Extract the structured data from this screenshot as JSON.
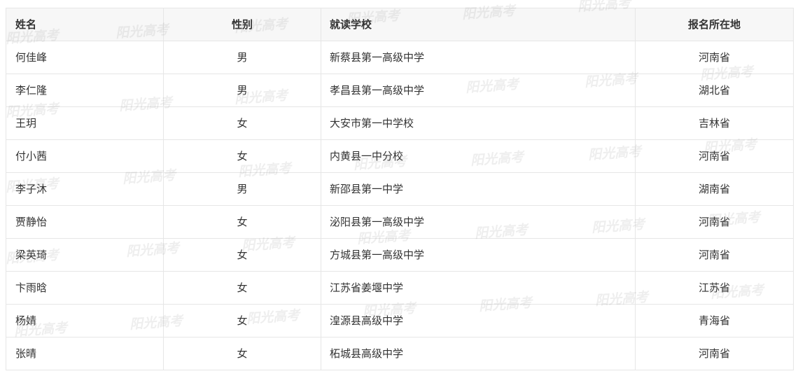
{
  "table": {
    "headers": {
      "name": "姓名",
      "gender": "性别",
      "school": "就读学校",
      "province": "报名所在地"
    },
    "rows": [
      {
        "name": "何佳峰",
        "gender": "男",
        "school": "新蔡县第一高级中学",
        "province": "河南省"
      },
      {
        "name": "李仁隆",
        "gender": "男",
        "school": "孝昌县第一高级中学",
        "province": "湖北省"
      },
      {
        "name": "王玥",
        "gender": "女",
        "school": "大安市第一中学校",
        "province": "吉林省"
      },
      {
        "name": "付小茜",
        "gender": "女",
        "school": "内黄县一中分校",
        "province": "河南省"
      },
      {
        "name": "李子沐",
        "gender": "男",
        "school": "新邵县第一中学",
        "province": "湖南省"
      },
      {
        "name": "贾静怡",
        "gender": "女",
        "school": "泌阳县第一高级中学",
        "province": "河南省"
      },
      {
        "name": "梁英琦",
        "gender": "女",
        "school": "方城县第一高级中学",
        "province": "河南省"
      },
      {
        "name": "卞雨晗",
        "gender": "女",
        "school": "江苏省姜堰中学",
        "province": "江苏省"
      },
      {
        "name": "杨婧",
        "gender": "女",
        "school": "湟源县高级中学",
        "province": "青海省"
      },
      {
        "name": "张晴",
        "gender": "女",
        "school": "柘城县高级中学",
        "province": "河南省"
      }
    ]
  },
  "watermark": {
    "text": "阳光高考",
    "color": "#787878"
  }
}
